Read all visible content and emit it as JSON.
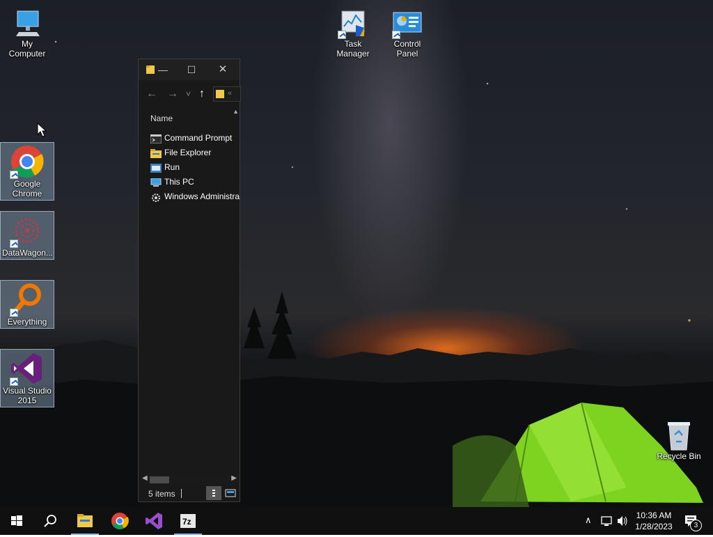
{
  "desktop": {
    "icons": [
      {
        "label": "My Computer"
      },
      {
        "label": "Task Manager"
      },
      {
        "label": "Control Panel"
      },
      {
        "label": "Google Chrome"
      },
      {
        "label": "DataWagon..."
      },
      {
        "label": "Everything"
      },
      {
        "label": "Visual Studio 2015"
      },
      {
        "label": "Recycle Bin"
      }
    ]
  },
  "explorer": {
    "window_controls": {
      "minimize": "—",
      "maximize": "☐",
      "close": "✕"
    },
    "nav": {
      "back": "←",
      "forward": "→",
      "recent": "˅",
      "up": "↑",
      "address_overflow": "«"
    },
    "column_header": "Name",
    "items": [
      {
        "name": "Command Prompt",
        "icon": "command-prompt-icon"
      },
      {
        "name": "File Explorer",
        "icon": "file-explorer-icon"
      },
      {
        "name": "Run",
        "icon": "run-icon"
      },
      {
        "name": "This PC",
        "icon": "this-pc-icon"
      },
      {
        "name": "Windows Administra",
        "icon": "windows-admin-tools-icon"
      }
    ],
    "status": {
      "count": "5 items"
    }
  },
  "taskbar": {
    "start": "windows-start-icon",
    "search": "search-icon",
    "apps": [
      {
        "name": "File Explorer",
        "icon": "file-explorer-icon",
        "active": true
      },
      {
        "name": "Google Chrome",
        "icon": "chrome-icon",
        "active": false
      },
      {
        "name": "Visual Studio",
        "icon": "visual-studio-icon",
        "active": false
      },
      {
        "name": "7-Zip",
        "icon": "seven-zip-icon",
        "label": "7z",
        "active": true
      }
    ],
    "tray": {
      "chevron": "∧",
      "time": "10:36 AM",
      "date": "1/28/2023",
      "notifications": "3"
    }
  },
  "colors": {
    "taskbar_bg": "#101010",
    "explorer_bg": "#191919",
    "accent": "#76b9ed",
    "tent_green": "#7ed321"
  }
}
